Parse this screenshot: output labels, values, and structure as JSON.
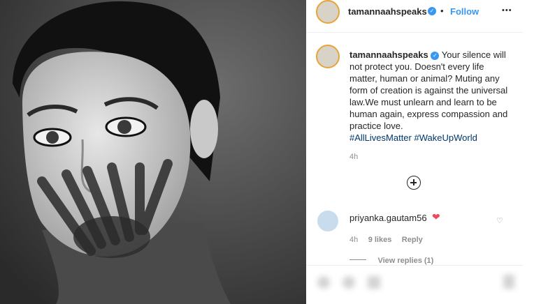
{
  "post": {
    "username": "tamannaahspeaks",
    "follow_label": "Follow",
    "more_label": "•••",
    "caption": "Your silence will not protect you. Doesn't every life matter, human or animal? Muting any form of creation is against the universal law.We must unlearn and learn to be human again, express compassion and practice love.",
    "hashtags": [
      "#AllLivesMatter",
      "#WakeUpWorld"
    ],
    "caption_time": "4h"
  },
  "comment": {
    "username": "priyanka.gautam56",
    "time": "4h",
    "likes": "9 likes",
    "reply_label": "Reply",
    "view_replies": "View replies (1)"
  },
  "colors": {
    "link": "#3897f0",
    "hashtag": "#00376b",
    "heart": "#ed4956",
    "avatar_ring": "#e8a33a"
  },
  "icons": {
    "verified": "verified-badge-icon",
    "more": "more-options-icon",
    "add_comment": "plus-circle-icon",
    "comment_heart": "red-heart-emoji",
    "like_comment": "heart-outline-icon",
    "blurred_actions": [
      "heart-icon",
      "comment-icon",
      "share-icon",
      "bookmark-icon"
    ]
  }
}
